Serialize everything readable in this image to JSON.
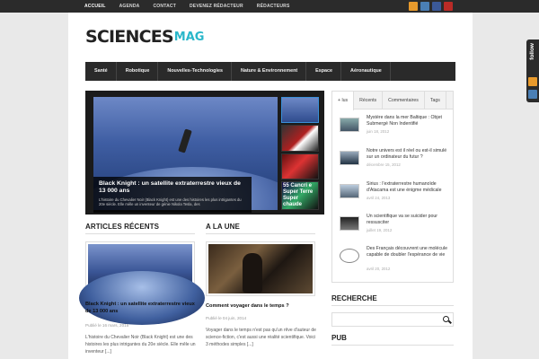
{
  "topnav": [
    "ACCUEIL",
    "AGENDA",
    "CONTACT",
    "DEVENEZ RÉDACTEUR",
    "RÉDACTEURS"
  ],
  "social": [
    {
      "name": "rss-icon",
      "color": "#e89a2c"
    },
    {
      "name": "email-icon",
      "color": "#4a7fb5"
    },
    {
      "name": "facebook-icon",
      "color": "#3b5998"
    },
    {
      "name": "youtube-icon",
      "color": "#b92b27"
    }
  ],
  "logo": {
    "part1": "SCIENCES",
    "part2": "MAG"
  },
  "mainnav": [
    "Santé",
    "Robotique",
    "Nouvelles-Technologies",
    "Nature & Environnement",
    "Espace",
    "Aéronautique"
  ],
  "slider": {
    "title": "Black Knight : un satellite extraterrestre vieux de 13 000 ans",
    "excerpt": "L'histoire du Chevalier Noir (Black Knight) est une des histoires les plus intrigantes du 20e siècle. Elle mêle un inventeur de génie Nikola Tesla, des",
    "thumb4_text": "55 Cancri e Super Terre Super chaude"
  },
  "recent": {
    "heading": "ARTICLES RÉCENTS",
    "title": "Black Knight : un satellite extraterrestre vieux de 13 000 ans",
    "meta": "Publié le 16 mars, 2015",
    "text": "L'histoire du Chevalier Noir (Black Knight) est une des histoires les plus intrigantes du 20e siècle. Elle mêle un inventeur [...]"
  },
  "featured": {
    "heading": "A LA UNE",
    "title": "Comment voyager dans le temps ?",
    "meta": "Publié le 04 juin, 2014",
    "text": "Voyager dans le temps n'est pas qu'un rêve d'auteur de science-fiction, c'est aussi une réalité scientifique. Voici 3 méthodes simples [...]"
  },
  "tabs": [
    "+ lus",
    "Récents",
    "Commentaires",
    "Tags"
  ],
  "tab_items": [
    {
      "title": "Mystère dans la mer Baltique : Objet Submergé Non Indentifié",
      "date": "juin 18, 2012"
    },
    {
      "title": "Notre univers est il réel ou est-il simulé sur un ordinateur du futur ?",
      "date": "décembre 15, 2012"
    },
    {
      "title": "Sirius : l'extraterrestre humanoïde d'Atacama est une énigme médicale",
      "date": "avril 24, 2013"
    },
    {
      "title": "Un scientifique va se suicider pour ressusciter",
      "date": "juillet 19, 2012"
    },
    {
      "title": "Des Français découvrent une molécule capable de doubler l'espérance de vie",
      "date": "avril 20, 2012"
    }
  ],
  "sidebar": {
    "search_heading": "RECHERCHE",
    "pub_heading": "PUB"
  },
  "follow": {
    "label": "follow"
  }
}
